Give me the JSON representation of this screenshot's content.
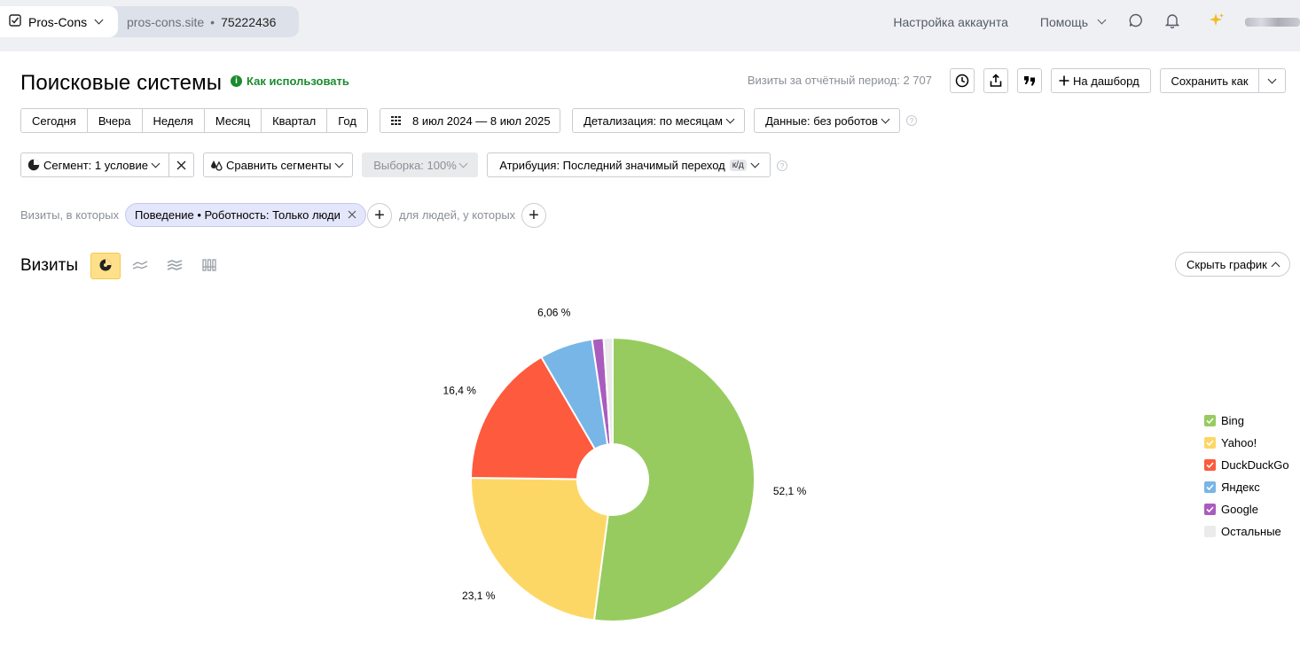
{
  "topbar": {
    "app_name": "Pros-Cons",
    "site": "pros-cons.site",
    "separator": "•",
    "counter_id": "75222436",
    "account_settings": "Настройка аккаунта",
    "help": "Помощь"
  },
  "header": {
    "title": "Поисковые системы",
    "howto_label": "Как использовать",
    "howto_icon": "i",
    "visits_period": "Визиты за отчётный период: 2 707",
    "dashboard_button": "На дашборд",
    "save_as_button": "Сохранить как"
  },
  "periods": [
    "Сегодня",
    "Вчера",
    "Неделя",
    "Месяц",
    "Квартал",
    "Год"
  ],
  "date_range": "8 июл 2024 — 8 июл 2025",
  "detail_select": "Детализация: по месяцам",
  "data_select": "Данные: без роботов",
  "help_glyph": "?",
  "segment": {
    "label": "Сегмент: 1 условие",
    "compare": "Сравнить сегменты",
    "sample": "Выборка: 100%",
    "attribution": "Атрибуция: Последний значимый переход",
    "attribution_badge": "к/д"
  },
  "filters": {
    "visits_prefix": "Визиты, в которых",
    "chip_label": "Поведение • Роботность: Только люди",
    "people_prefix": "для людей, у которых",
    "add_glyph": "+"
  },
  "chart_panel": {
    "title": "Визиты",
    "hide_chart": "Скрыть график"
  },
  "icons": {
    "app": "checkbox-icon",
    "chat": "chat-bubble-icon",
    "bell": "bell-icon",
    "sparkle": "sparkle-icon",
    "clock": "clock-icon",
    "export": "export-icon",
    "quote": "quote-icon"
  },
  "colors": {
    "Bing": "#97cb60",
    "Yahoo!": "#fdd766",
    "DuckDuckGo": "#fd5a3e",
    "Яндекс": "#77b6e7",
    "Google": "#a95cbe",
    "Остальные": "#ebebeb"
  },
  "chart_data": {
    "type": "pie",
    "donut": true,
    "series_name": "Визиты",
    "slices": [
      {
        "label": "Bing",
        "value": 52.1,
        "label_text": "52,1 %"
      },
      {
        "label": "Yahoo!",
        "value": 23.1,
        "label_text": "23,1 %"
      },
      {
        "label": "DuckDuckGo",
        "value": 16.4,
        "label_text": "16,4 %"
      },
      {
        "label": "Яндекс",
        "value": 6.06,
        "label_text": "6,06 %"
      },
      {
        "label": "Google",
        "value": 1.3,
        "label_text": ""
      },
      {
        "label": "Остальные",
        "value": 1.04,
        "label_text": ""
      }
    ],
    "legend_position": "right"
  }
}
